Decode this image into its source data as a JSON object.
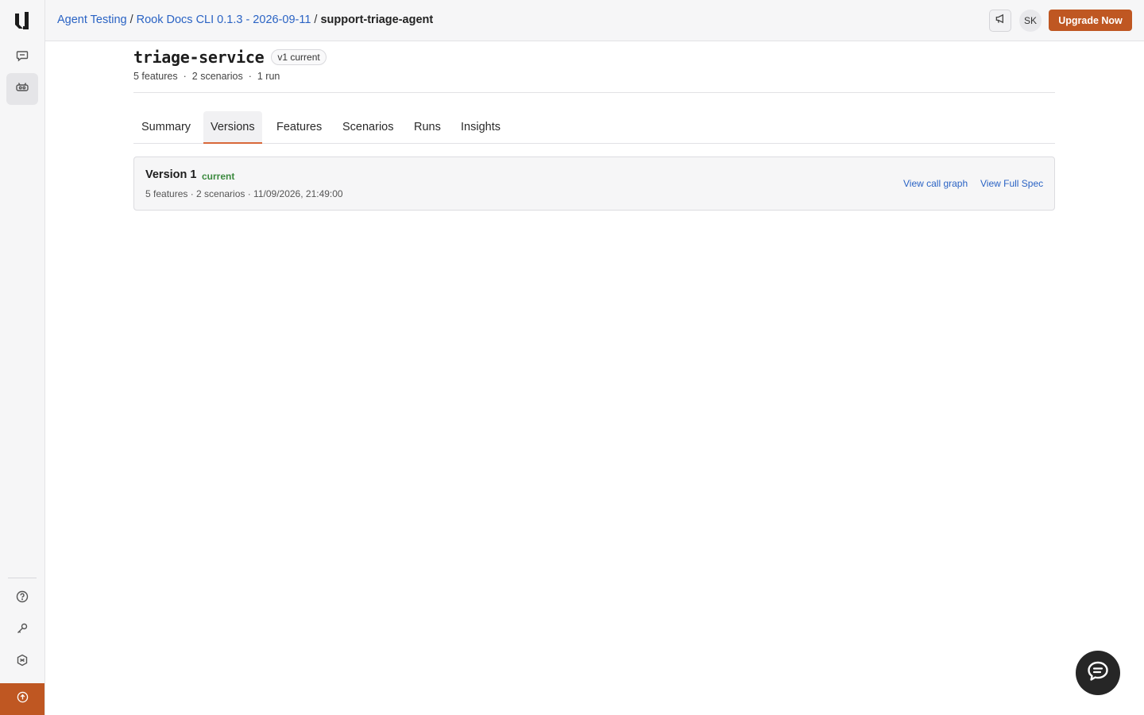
{
  "breadcrumb": {
    "items": [
      "Agent Testing",
      "Rook Docs CLI 0.1.3 - 2026-09-11"
    ],
    "separator": "/",
    "current": "support-triage-agent"
  },
  "header": {
    "announce_icon": "megaphone-icon",
    "avatar_initials": "SK",
    "upgrade_label": "Upgrade Now"
  },
  "sidebar": {
    "items": [
      {
        "name": "chat",
        "icon": "chat-icon",
        "active": false
      },
      {
        "name": "agent-testing",
        "icon": "agent-icon",
        "active": true
      }
    ],
    "bottom_items": [
      {
        "name": "help",
        "icon": "help-icon"
      },
      {
        "name": "keys",
        "icon": "key-icon"
      },
      {
        "name": "settings",
        "icon": "settings-icon"
      }
    ],
    "upgrade_icon": "arrow-up-circle-icon"
  },
  "page": {
    "title": "triage-service",
    "version_badge": "v1 current",
    "meta": [
      "5 features",
      "2 scenarios",
      "1 run"
    ],
    "meta_separator": "·"
  },
  "tabs": {
    "items": [
      "Summary",
      "Versions",
      "Features",
      "Scenarios",
      "Runs",
      "Insights"
    ],
    "active": "Versions"
  },
  "versions": [
    {
      "title": "Version 1",
      "status": "current",
      "meta": "5 features · 2 scenarios · 11/09/2026, 21:49:00",
      "links": [
        "View call graph",
        "View Full Spec"
      ]
    }
  ],
  "colors": {
    "accent": "#bf5722",
    "link": "#2a63c4",
    "success": "#3c8a3f",
    "tab_indicator": "#d8683a"
  }
}
